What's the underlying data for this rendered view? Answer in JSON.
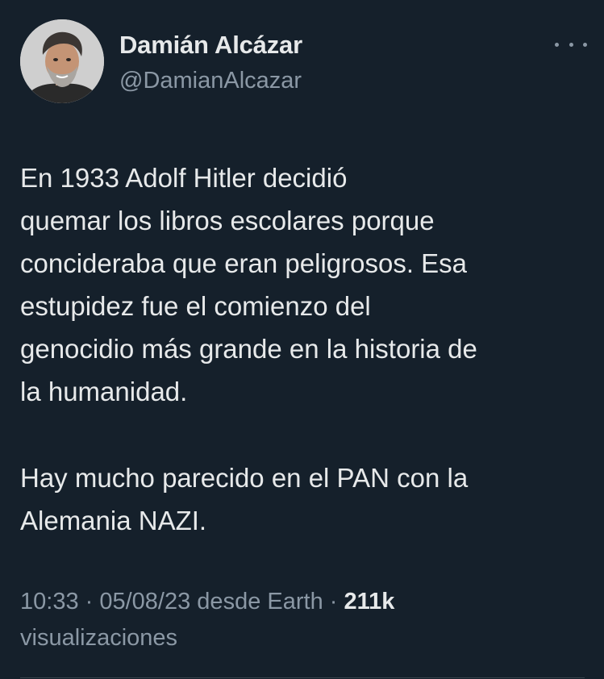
{
  "author": {
    "display_name": "Damián Alcázar",
    "handle": "@DamianAlcazar"
  },
  "tweet": {
    "paragraph_1": "En 1933 Adolf Hitler decidió\nquemar los libros escolares porque\nconcideraba que eran peligrosos. Esa\nestupidez fue el comienzo del\ngenocidio más grande en la historia de\nla humanidad.",
    "paragraph_2": "Hay mucho parecido en el PAN con la\nAlemania NAZI."
  },
  "meta": {
    "time": "10:33",
    "separator_1": " · ",
    "date": "05/08/23",
    "source": " desde Earth",
    "separator_2": " · ",
    "views_count": "211k",
    "views_label": "visualizaciones"
  },
  "icons": {
    "more": "more-options-icon",
    "avatar": "avatar"
  },
  "colors": {
    "background": "#15202b",
    "primary_text": "#e7e9ea",
    "secondary_text": "#8b98a5",
    "divider": "#38444d"
  }
}
